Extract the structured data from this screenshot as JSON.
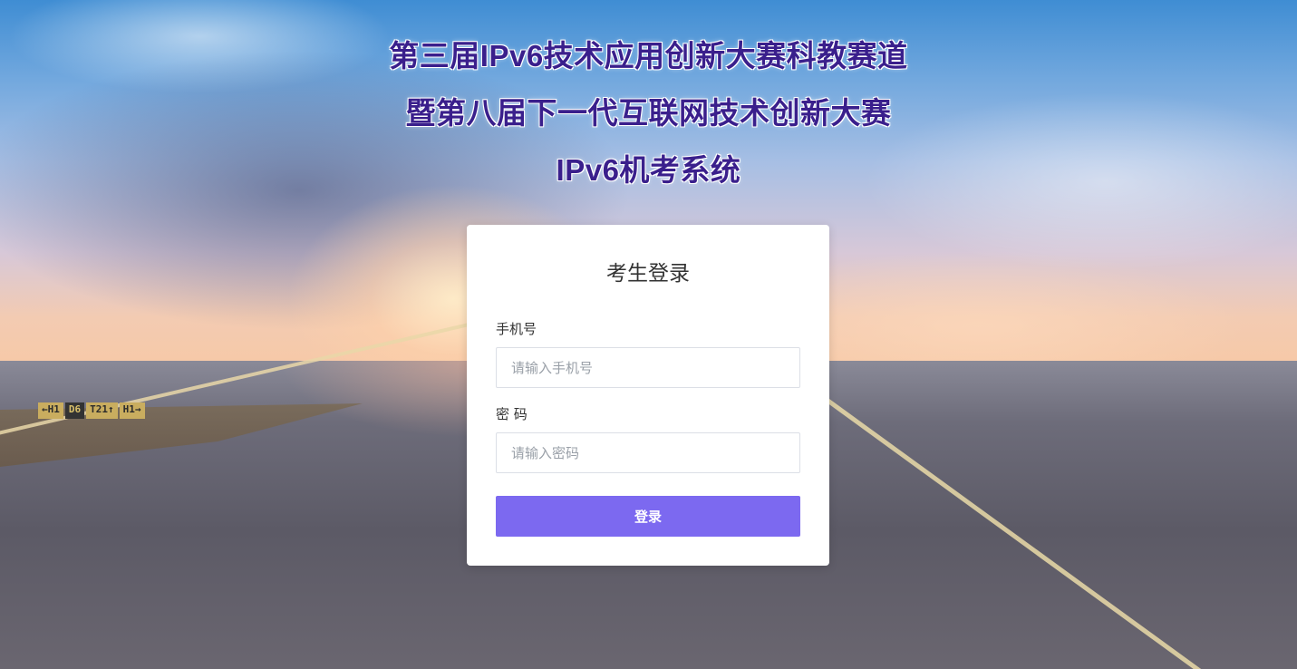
{
  "page": {
    "title_lines": [
      "第三届IPv6技术应用创新大赛科教赛道",
      "暨第八届下一代互联网技术创新大赛",
      "IPv6机考系统"
    ]
  },
  "background": {
    "runway_sign": [
      "←H1",
      "D6",
      "T21↑",
      "H1→"
    ]
  },
  "login": {
    "title": "考生登录",
    "phone_label": "手机号",
    "phone_placeholder": "请输入手机号",
    "password_label": "密 码",
    "password_placeholder": "请输入密码",
    "submit_label": "登录"
  },
  "colors": {
    "title": "#3a1f8c",
    "button": "#7c69f0"
  }
}
